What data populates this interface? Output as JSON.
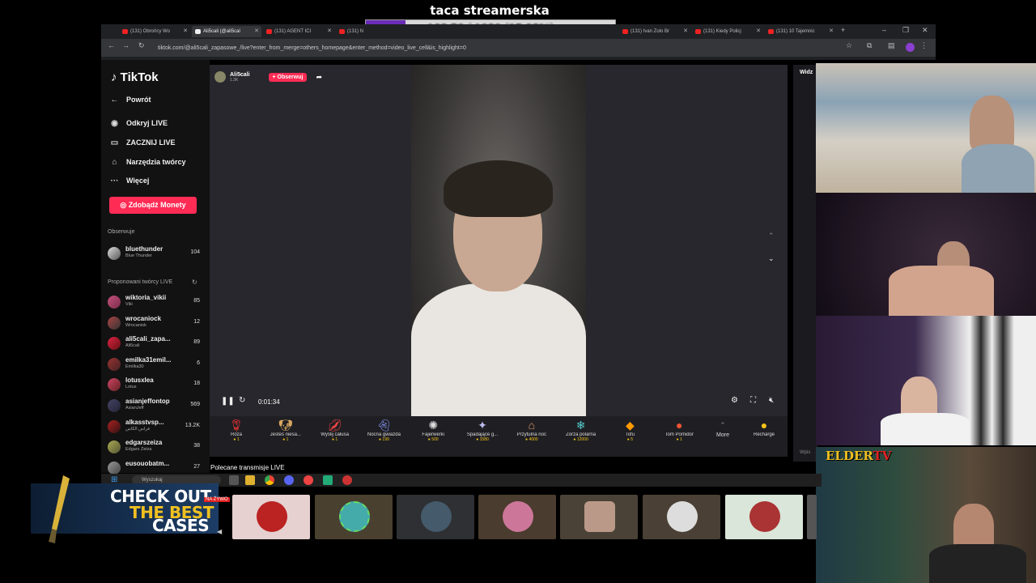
{
  "overlay": {
    "goal_title": "taca streamerska",
    "goal_text": "162.50 / 1020 (15.93%)",
    "goal_fraction": 0.1593
  },
  "browser": {
    "tabs": [
      {
        "label": "(131) Obrońcy Wo"
      },
      {
        "label": "Ali5cali (@ali5cal"
      },
      {
        "label": "(131) AGENT ICI"
      },
      {
        "label": "(131) N"
      },
      {
        "label": "(131) Ivan Zolo Br"
      },
      {
        "label": "(131) Kiedy Policj"
      },
      {
        "label": "(131) 10 Tajemnic"
      }
    ],
    "url": "tiktok.com/@ali5cali_zapasowe_/live?enter_from_merge=others_homepage&enter_method=video_live_cell&is_highlight=0"
  },
  "sidebar": {
    "logo": "TikTok",
    "nav": [
      {
        "label": "Powrót",
        "icon": "back-arrow-icon"
      },
      {
        "label": "Odkryj LIVE",
        "icon": "live-icon"
      },
      {
        "label": "ZACZNIJ LIVE",
        "icon": "camera-icon"
      },
      {
        "label": "Narzędzia twórcy",
        "icon": "home-icon"
      },
      {
        "label": "Więcej",
        "icon": "more-icon"
      }
    ],
    "coins_button": "Zdobądź Monety",
    "following_title": "Obserwuje",
    "following": [
      {
        "name": "bluethunder",
        "sub": "Blue Thunder",
        "count": "104"
      }
    ],
    "suggested_title": "Proponowani twórcy LIVE",
    "suggested": [
      {
        "name": "wiktoria_vikii",
        "sub": "Viki",
        "count": "85"
      },
      {
        "name": "wrocaniock",
        "sub": "Wrocaniok",
        "count": "12"
      },
      {
        "name": "ali5cali_zapa...",
        "sub": "Ali5cali",
        "count": "89"
      },
      {
        "name": "emilka31emil...",
        "sub": "Emilka30",
        "count": "6"
      },
      {
        "name": "lotusxlea",
        "sub": "Lotus",
        "count": "18"
      },
      {
        "name": "asianjeffontop",
        "sub": "AsianJeff",
        "count": "569"
      },
      {
        "name": "alkasstvsp...",
        "sub": "فراس الكاس",
        "count": "13.2K"
      },
      {
        "name": "edgarszeiza",
        "sub": "Edgars Zeiza",
        "count": "38"
      },
      {
        "name": "eusouobatm...",
        "sub": "",
        "count": "27"
      }
    ]
  },
  "player": {
    "streamer_name": "Ali5cali",
    "streamer_likes": "1.3K",
    "follow_label": "+ Obserwuj",
    "time": "0:01:34"
  },
  "gifts": [
    {
      "name": "Róża",
      "price": "1",
      "icon": "rose-icon"
    },
    {
      "name": "Jesteś niesa...",
      "price": "1",
      "icon": "dog-icon"
    },
    {
      "name": "Wyślij całusa",
      "price": "1",
      "icon": "lips-icon"
    },
    {
      "name": "Nocna gwiazda",
      "price": "199",
      "icon": "ghost-icon"
    },
    {
      "name": "Fajerwerki",
      "price": "500",
      "icon": "firework-icon"
    },
    {
      "name": "Spadające g...",
      "price": "1580",
      "icon": "star-icon"
    },
    {
      "name": "Przytulna noc",
      "price": "4000",
      "icon": "house-icon"
    },
    {
      "name": "Zorza polarna",
      "price": "12000",
      "icon": "aurora-icon"
    },
    {
      "name": "Tofu",
      "price": "5",
      "icon": "tofu-icon"
    },
    {
      "name": "Tom Pomidor",
      "price": "1",
      "icon": "tomato-icon"
    }
  ],
  "gift_more": "More",
  "recharge": "Recharge",
  "recommended_title": "Polecane transmisje LIVE",
  "chat_header": "Widz",
  "chat_input_placeholder": "Wpis",
  "taskbar": {
    "search_placeholder": "Wyszukaj"
  },
  "banner": {
    "line1": "CHECK OUT",
    "line2": "THE BEST",
    "line3": "CASES"
  },
  "live_badge": "NA ŻYWO",
  "elder_logo": "ELDER",
  "elder_logo_suffix": "TV",
  "colors": {
    "tiktok_pink": "#fe2c55",
    "goal_purple": "#6a2bb8"
  }
}
